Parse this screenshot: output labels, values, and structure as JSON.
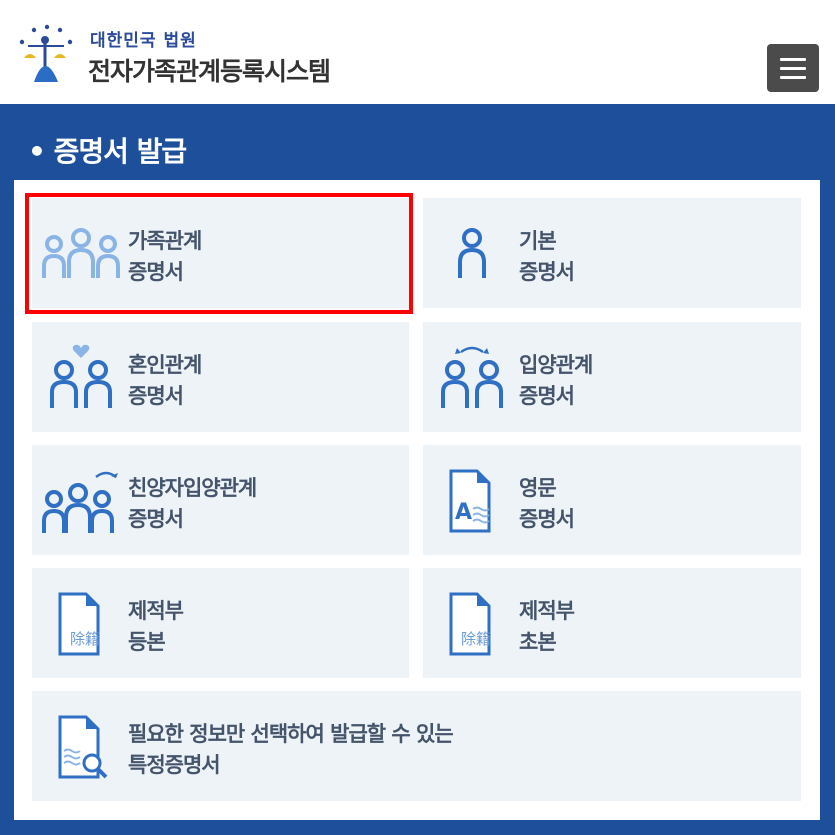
{
  "header": {
    "org_name": "대한민국 법원",
    "system_name": "전자가족관계등록시스템",
    "logo_icon": "court-emblem-icon",
    "menu_icon": "hamburger-menu-icon"
  },
  "section": {
    "title": "• 증명서 발급"
  },
  "cards": [
    {
      "line1": "가족관계",
      "line2": "증명서",
      "icon": "family-group-icon"
    },
    {
      "line1": "기본",
      "line2": "증명서",
      "icon": "person-icon"
    },
    {
      "line1": "혼인관계",
      "line2": "증명서",
      "icon": "couple-heart-icon"
    },
    {
      "line1": "입양관계",
      "line2": "증명서",
      "icon": "adoption-arrows-icon"
    },
    {
      "line1": "친양자입양관계",
      "line2": "증명서",
      "icon": "family-adoption-icon"
    },
    {
      "line1": "영문",
      "line2": "증명서",
      "icon": "english-document-icon"
    },
    {
      "line1": "제적부",
      "line2": "등본",
      "icon": "removed-register-document-icon",
      "badge": "除籍"
    },
    {
      "line1": "제적부",
      "line2": "초본",
      "icon": "removed-register-document-icon",
      "badge": "除籍"
    },
    {
      "line1": "필요한 정보만 선택하여 발급할 수 있는",
      "line2": "특정증명서",
      "icon": "document-search-icon"
    }
  ],
  "colors": {
    "brand_blue": "#1d4f9a",
    "card_bg": "#eef3f8",
    "icon_blue": "#2f6fc4",
    "icon_light": "#8ab4e6",
    "highlight": "#ff0000"
  }
}
